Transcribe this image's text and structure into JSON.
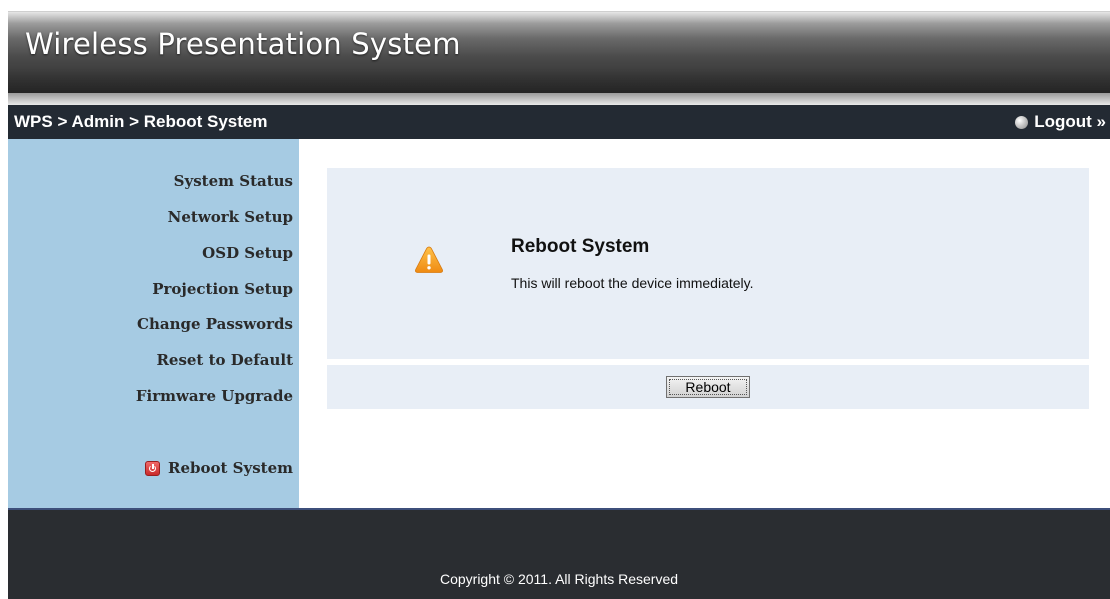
{
  "header": {
    "title": "Wireless Presentation System"
  },
  "breadcrumb": {
    "text": "WPS > Admin > Reboot System"
  },
  "logout": {
    "label": "Logout »"
  },
  "sidebar": {
    "items": [
      {
        "label": "System Status"
      },
      {
        "label": "Network Setup"
      },
      {
        "label": "OSD Setup"
      },
      {
        "label": "Projection Setup"
      },
      {
        "label": "Change Passwords"
      },
      {
        "label": "Reset to Default"
      },
      {
        "label": "Firmware Upgrade"
      }
    ],
    "reboot": {
      "label": "Reboot System",
      "icon": "power-icon"
    }
  },
  "main": {
    "icon": "warning-icon",
    "title": "Reboot System",
    "message": "This will reboot the device immediately.",
    "button_label": "Reboot"
  },
  "footer": {
    "copyright": "Copyright © 2011. All Rights Reserved"
  },
  "colors": {
    "sidebar_bg": "#a6cbe3",
    "breadcrumb_bg": "#232a33",
    "panel_bg": "#e8eef6",
    "footer_bg": "#2a2d31",
    "warning": "#f29a1e"
  }
}
